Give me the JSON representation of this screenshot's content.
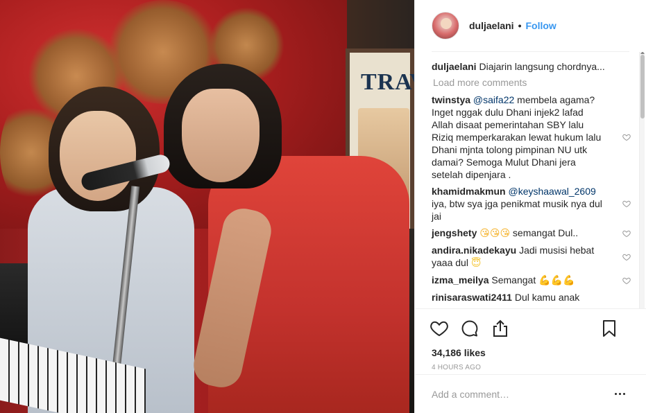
{
  "post": {
    "username": "duljaelani",
    "follow_label": "Follow",
    "caption_user": "duljaelani",
    "caption_text": "Diajarin langsung chordnya...",
    "load_more": "Load more comments",
    "likes": "34,186 likes",
    "time": "4 HOURS AGO",
    "add_comment_placeholder": "Add a comment…"
  },
  "poster": {
    "title": "TRAVE"
  },
  "comments": [
    {
      "user": "twinstya",
      "mention": "@saifa22",
      "text": " membela agama? Inget nggak dulu Dhani injek2 lafad Allah disaat pemerintahan SBY lalu Riziq memperkarakan lewat hukum lalu Dhani mjnta tolong pimpinan NU utk damai? Semoga Mulut Dhani jera setelah dipenjara ."
    },
    {
      "user": "khamidmakmun",
      "mention": "@keyshaawal_2609",
      "text": " iya, btw sya jga penikmat musik nya dul jai"
    },
    {
      "user": "jengshety",
      "emoji": "😘😘😘",
      "text": " semangat Dul.."
    },
    {
      "user": "andira.nikadekayu",
      "text": " Jadi musisi hebat yaaa dul ",
      "emoji": "😇"
    },
    {
      "user": "izma_meilya",
      "text": " Semangat ",
      "emoji": "💪💪💪"
    },
    {
      "user": "rinisaraswati2411",
      "text": " Dul kamu anak"
    }
  ],
  "icons": {
    "like": "heart-icon",
    "comment": "comment-icon",
    "share": "share-icon",
    "save": "bookmark-icon",
    "more": "more-options-icon"
  },
  "colors": {
    "link": "#3897f0",
    "text": "#262626",
    "muted": "#999999",
    "mention": "#003569"
  }
}
